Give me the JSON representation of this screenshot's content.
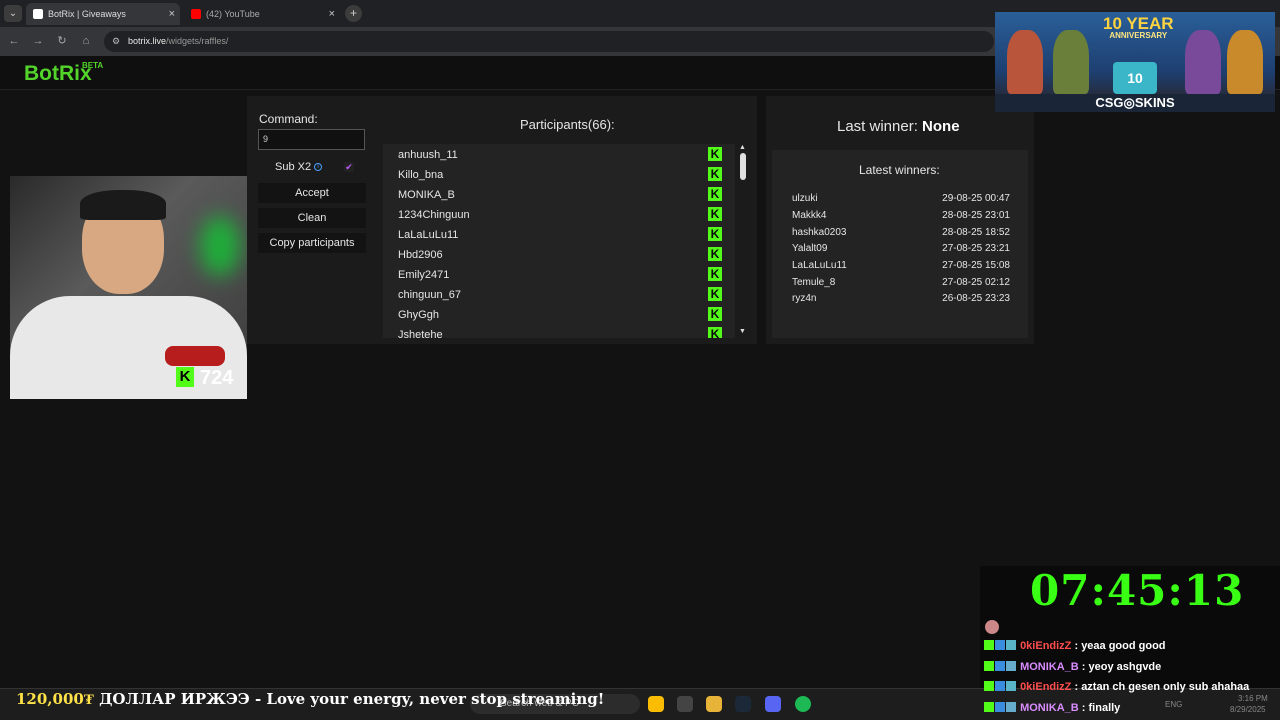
{
  "browser": {
    "tabs": [
      {
        "label": "BotRix | Giveaways",
        "active": true
      },
      {
        "label": "(42) YouTube",
        "active": false
      }
    ],
    "url_host": "botrix.live",
    "url_path": "/widgets/raffles/",
    "new_tab_symbol": "+",
    "close_symbol": "×"
  },
  "header": {
    "logo": "BotRix",
    "beta": "BETA"
  },
  "raffle": {
    "command_label": "Command:",
    "command_value": "9",
    "sub_label": "Sub X2",
    "sub_checked": true,
    "buttons": [
      "Accept",
      "Clean",
      "Copy participants"
    ],
    "participants_title": "Participants(66):",
    "participants": [
      "anhuush_11",
      "Killo_bna",
      "MONIKA_B",
      "1234Chinguun",
      "LaLaLuLu11",
      "Hbd2906",
      "Emily2471",
      "chinguun_67",
      "GhyGgh",
      "Jshetehe"
    ],
    "platform_icon": "kick-icon"
  },
  "winners": {
    "last_winner_label": "Last winner:",
    "last_winner_value": "None",
    "latest_title": "Latest winners:",
    "list": [
      {
        "name": "ulzuki",
        "date": "29-08-25 00:47"
      },
      {
        "name": "Makkk4",
        "date": "28-08-25 23:01"
      },
      {
        "name": "hashka0203",
        "date": "28-08-25 18:52"
      },
      {
        "name": "Yalalt09",
        "date": "27-08-25 23:21"
      },
      {
        "name": "LaLaLuLu11",
        "date": "27-08-25 15:08"
      },
      {
        "name": "Temule_8",
        "date": "27-08-25 02:12"
      },
      {
        "name": "ryz4n",
        "date": "26-08-25 23:23"
      }
    ]
  },
  "overlay": {
    "viewer_count": "724",
    "sponsor_title": "10 YEAR",
    "sponsor_subtitle": "ANNIVERSARY",
    "sponsor_cake": "10",
    "sponsor_brand": "CSG◎SKINS",
    "timer": "07:45:13",
    "ticker_amount": "120,000₮",
    "ticker_text": " ДОЛЛАР ИРЖЭЭ - Love your energy, never stop streaming!"
  },
  "chat": [
    {
      "user": "0kiEndizZ",
      "message": "yeaa good good",
      "color": "#ff4d4d"
    },
    {
      "user": "MONIKA_B",
      "message": "yeoy ashgvde",
      "color": "#d98cff"
    },
    {
      "user": "0kiEndizZ",
      "message": "aztan ch gesen only sub ahahaa",
      "color": "#ff4d4d"
    },
    {
      "user": "MONIKA_B",
      "message": "finally",
      "color": "#d98cff"
    }
  ],
  "taskbar": {
    "search_placeholder": "Search web & PC",
    "lang": "ENG",
    "time": "3:16 PM",
    "date": "8/29/2025"
  },
  "colors": {
    "accent": "#53d42a",
    "kick": "#53fc18",
    "timer": "#39ff14"
  }
}
